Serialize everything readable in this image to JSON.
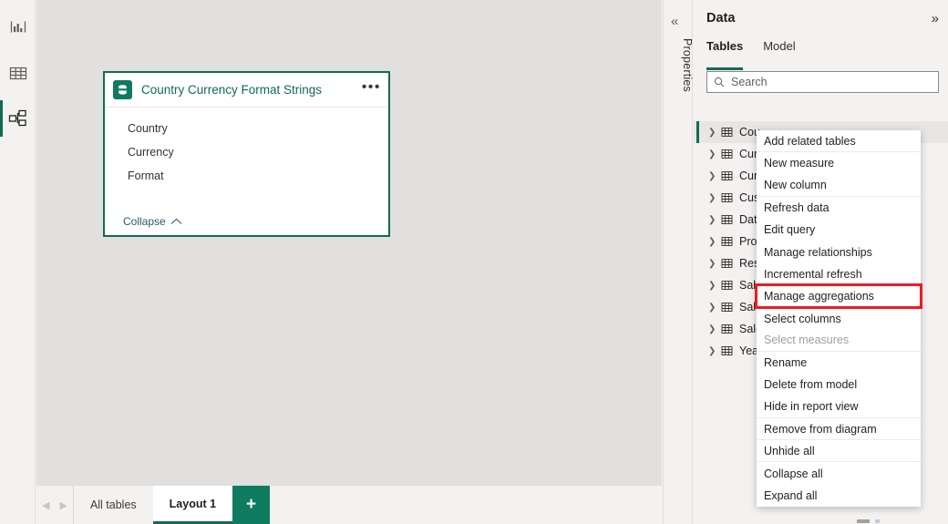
{
  "view_rail": {
    "items": [
      {
        "name": "report-view",
        "icon": "bar-chart-icon",
        "active": false
      },
      {
        "name": "data-view",
        "icon": "table-grid-icon",
        "active": false
      },
      {
        "name": "model-view",
        "icon": "model-diagram-icon",
        "active": true
      }
    ]
  },
  "canvas": {
    "table_card": {
      "icon": "table-database-icon",
      "title": "Country Currency Format Strings",
      "ellipsis_label": "•••",
      "fields": [
        "Country",
        "Currency",
        "Format"
      ],
      "collapse_label": "Collapse",
      "collapse_icon": "chevron-up-icon",
      "border_color": "#0f6b56",
      "icon_bg": "#0f7b60"
    }
  },
  "tab_strip": {
    "nav_prev": "◀",
    "nav_next": "▶",
    "tabs": [
      {
        "label": "All tables",
        "active": false
      },
      {
        "label": "Layout 1",
        "active": true
      }
    ],
    "add_label": "+",
    "add_bg": "#0f7b60"
  },
  "properties_rail": {
    "collapse_icon": "chevron-double-left-icon",
    "collapse_glyph": "«",
    "label": "Properties"
  },
  "data_pane": {
    "title": "Data",
    "expand_icon": "chevron-double-right-icon",
    "expand_glyph": "»",
    "tabs": [
      {
        "label": "Tables",
        "active": true
      },
      {
        "label": "Model",
        "active": false
      }
    ],
    "search": {
      "placeholder": "Search",
      "value": "",
      "icon": "search-icon"
    },
    "tables": [
      {
        "label": "Cou",
        "selected": true
      },
      {
        "label": "Cur",
        "selected": false
      },
      {
        "label": "Cur",
        "selected": false
      },
      {
        "label": "Cus",
        "selected": false
      },
      {
        "label": "Date",
        "selected": false
      },
      {
        "label": "Pro",
        "selected": false
      },
      {
        "label": "Res",
        "selected": false
      },
      {
        "label": "Sale",
        "selected": false
      },
      {
        "label": "Sale",
        "selected": false
      },
      {
        "label": "Sale",
        "selected": false
      },
      {
        "label": "Year",
        "selected": false
      }
    ]
  },
  "context_menu": {
    "highlight_color": "#ee1b24",
    "items": [
      {
        "label": "Add related tables",
        "disabled": false,
        "separator_after": true,
        "highlighted": false
      },
      {
        "label": "New measure",
        "disabled": false,
        "separator_after": false,
        "highlighted": false
      },
      {
        "label": "New column",
        "disabled": false,
        "separator_after": true,
        "highlighted": false
      },
      {
        "label": "Refresh data",
        "disabled": false,
        "separator_after": false,
        "highlighted": false
      },
      {
        "label": "Edit query",
        "disabled": false,
        "separator_after": false,
        "highlighted": false
      },
      {
        "label": "Manage relationships",
        "disabled": false,
        "separator_after": false,
        "highlighted": false
      },
      {
        "label": "Incremental refresh",
        "disabled": false,
        "separator_after": false,
        "highlighted": false
      },
      {
        "label": "Manage aggregations",
        "disabled": false,
        "separator_after": false,
        "highlighted": true
      },
      {
        "label": "Select columns",
        "disabled": false,
        "separator_after": false,
        "highlighted": false
      },
      {
        "label": "Select measures",
        "disabled": true,
        "separator_after": true,
        "highlighted": false
      },
      {
        "label": "Rename",
        "disabled": false,
        "separator_after": false,
        "highlighted": false
      },
      {
        "label": "Delete from model",
        "disabled": false,
        "separator_after": false,
        "highlighted": false
      },
      {
        "label": "Hide in report view",
        "disabled": false,
        "separator_after": true,
        "highlighted": false
      },
      {
        "label": "Remove from diagram",
        "disabled": false,
        "separator_after": true,
        "highlighted": false
      },
      {
        "label": "Unhide all",
        "disabled": false,
        "separator_after": true,
        "highlighted": false
      },
      {
        "label": "Collapse all",
        "disabled": false,
        "separator_after": false,
        "highlighted": false
      },
      {
        "label": "Expand all",
        "disabled": false,
        "separator_after": false,
        "highlighted": false
      }
    ]
  }
}
